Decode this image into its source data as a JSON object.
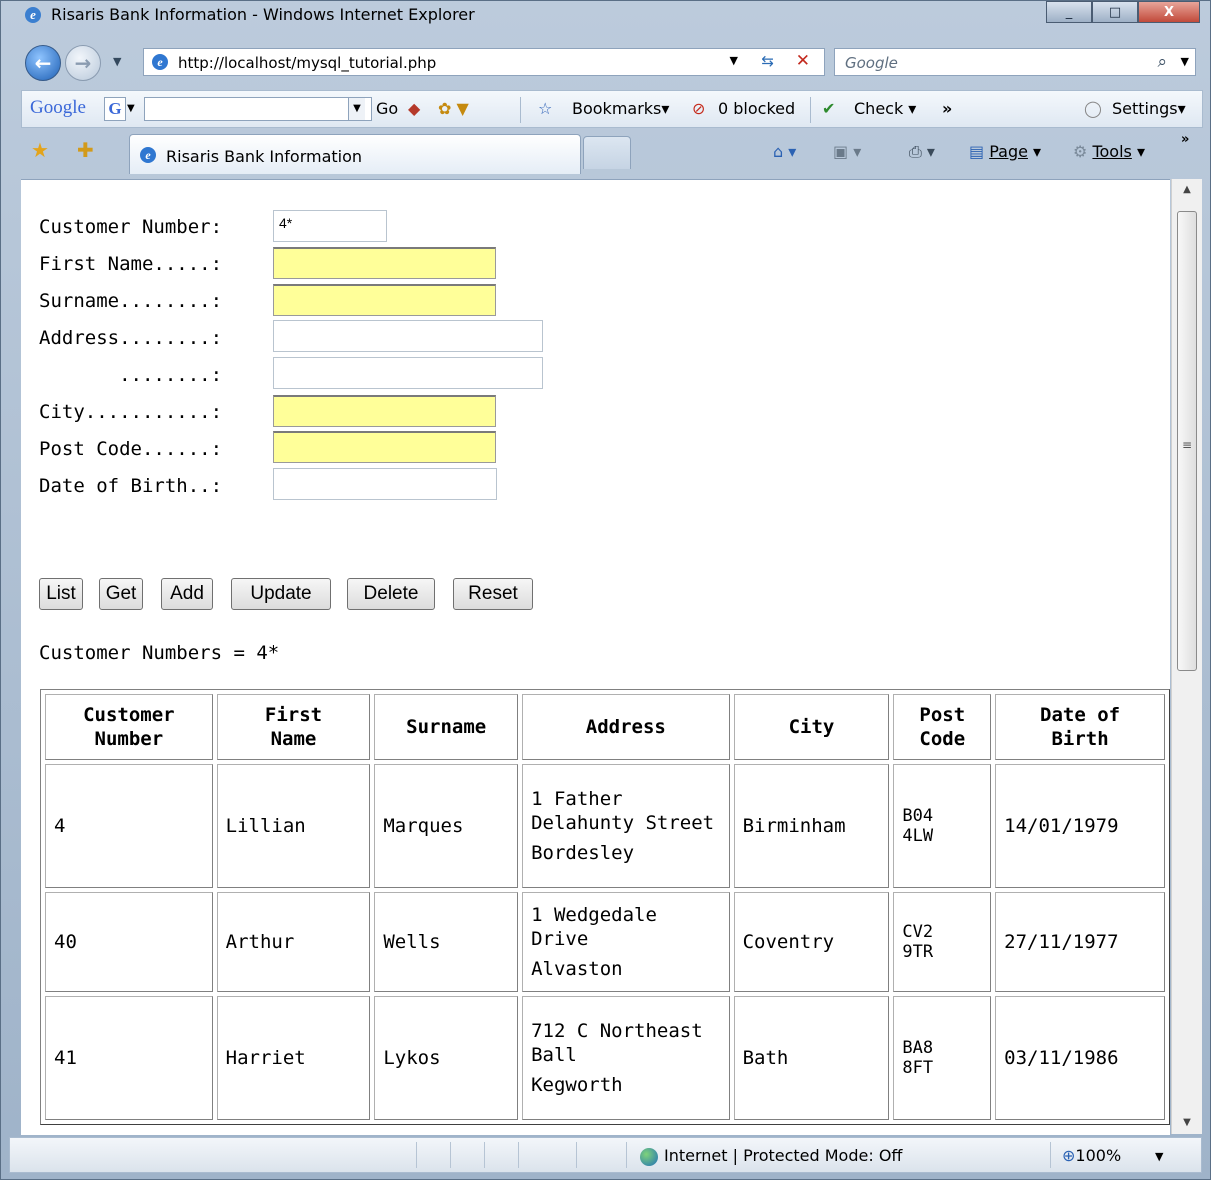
{
  "window": {
    "title": "Risaris Bank Information - Windows Internet Explorer",
    "controls": {
      "minimize": "_",
      "maximize": "□",
      "close": "X"
    }
  },
  "address_bar": {
    "url": "http://localhost/mysql_tutorial.php",
    "search_placeholder": "Google"
  },
  "google_toolbar": {
    "logo": "Google",
    "g_button": "G",
    "go": "Go",
    "bookmarks": "Bookmarks",
    "blocked": "0 blocked",
    "check": "Check",
    "more": "»",
    "settings": "Settings"
  },
  "tabs": [
    {
      "label": "Risaris Bank Information"
    }
  ],
  "command_bar": {
    "page": "Page",
    "tools": "Tools"
  },
  "form": {
    "customer_number_label": "Customer Number:",
    "customer_number_value": "4*",
    "first_name_label": "First Name.....:",
    "surname_label": "Surname........:",
    "address_label": "Address........:",
    "address2_label": "       ........:",
    "city_label": "City...........:",
    "post_code_label": "Post Code......:",
    "dob_label": "Date of Birth..:"
  },
  "buttons": {
    "list": "List",
    "get": "Get",
    "add": "Add",
    "update": "Update",
    "delete": "Delete",
    "reset": "Reset"
  },
  "result_summary": "Customer Numbers = 4*",
  "table": {
    "headers": [
      [
        "Customer",
        "Number"
      ],
      [
        "First",
        "Name"
      ],
      [
        "Surname"
      ],
      [
        "Address"
      ],
      [
        "City"
      ],
      [
        "Post",
        "Code"
      ],
      [
        "Date of",
        "Birth"
      ]
    ],
    "rows": [
      {
        "number": "4",
        "first": "Lillian",
        "surname": "Marques",
        "address1": "1 Father Delahunty Street",
        "address2": "Bordesley",
        "city": "Birminham",
        "post1": "B04",
        "post2": "4LW",
        "dob": "14/01/1979"
      },
      {
        "number": "40",
        "first": "Arthur",
        "surname": "Wells",
        "address1": "1 Wedgedale Drive",
        "address2": "Alvaston",
        "city": "Coventry",
        "post1": "CV2",
        "post2": "9TR",
        "dob": "27/11/1977"
      },
      {
        "number": "41",
        "first": "Harriet",
        "surname": "Lykos",
        "address1": "712 C Northeast Ball",
        "address2": "Kegworth",
        "city": "Bath",
        "post1": "BA8",
        "post2": "8FT",
        "dob": "03/11/1986"
      }
    ]
  },
  "status_bar": {
    "zone": "Internet | Protected Mode: Off",
    "zoom": "100%"
  }
}
